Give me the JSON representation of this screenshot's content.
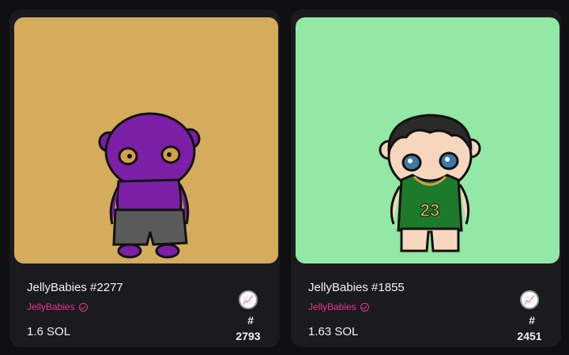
{
  "cards": [
    {
      "title": "JellyBabies #2277",
      "collection": "JellyBabies",
      "price": "1.6 SOL",
      "rank_symbol": "#",
      "rank_value": "2793",
      "background_color": "#d4ac5c",
      "accent_color": "#e8378a",
      "jersey_number": ""
    },
    {
      "title": "JellyBabies #1855",
      "collection": "JellyBabies",
      "price": "1.63 SOL",
      "rank_symbol": "#",
      "rank_value": "2451",
      "background_color": "#92e8a4",
      "accent_color": "#e8378a",
      "jersey_number": "23"
    }
  ],
  "icons": {
    "verified": "verified-check-icon",
    "rank_badge": "rarity-rank-icon"
  }
}
